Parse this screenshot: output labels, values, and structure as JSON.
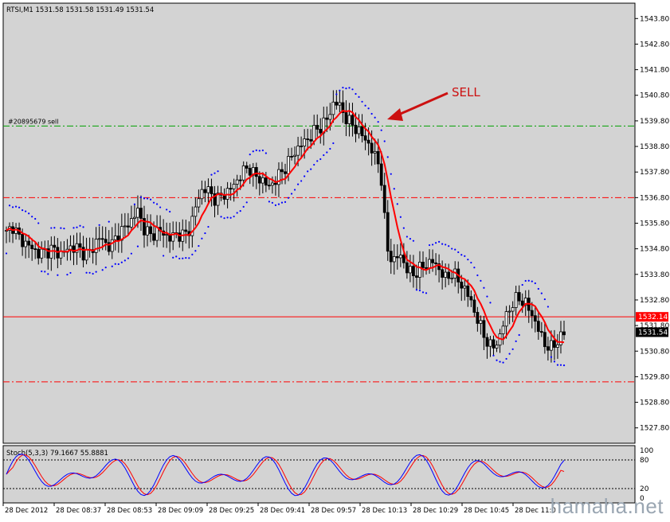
{
  "window": {
    "symbol_info": "RTSI,M1  1531.58 1531.58 1531.49 1531.54",
    "order_label": "#20895679 sell",
    "annotation": "SELL",
    "watermark": "hamaha.net"
  },
  "colors": {
    "background": "#d3d3d3",
    "candles": "#000000",
    "ma_line": "#ff0000",
    "parabolic_sar": "#0000ff",
    "order_line": "#00a000",
    "level_lines": "#ff0000",
    "stoch_main": "#0000ff",
    "stoch_signal": "#ff0000",
    "annotation": "#cc1111"
  },
  "price_axis": {
    "labels": [
      "1543.80",
      "1542.80",
      "1541.80",
      "1540.80",
      "1539.80",
      "1538.80",
      "1537.80",
      "1536.80",
      "1535.80",
      "1534.80",
      "1533.80",
      "1532.80",
      "1531.80",
      "1530.80",
      "1529.80",
      "1528.80",
      "1527.80"
    ],
    "current_price_tag": "1532.14",
    "last_price_tag": "1531.54"
  },
  "time_axis": {
    "labels": [
      "28 Dec 2012",
      "28 Dec 08:37",
      "28 Dec 08:53",
      "28 Dec 09:09",
      "28 Dec 09:25",
      "28 Dec 09:41",
      "28 Dec 09:57",
      "28 Dec 10:13",
      "28 Dec 10:29",
      "28 Dec 10:45",
      "28 Dec 11:0"
    ]
  },
  "stochastic": {
    "label": "Stoch(5,3,3) 79.1667 55.8881",
    "levels": [
      "100",
      "80",
      "20",
      "0"
    ]
  },
  "chart_data": {
    "type": "candlestick",
    "symbol": "RTSI",
    "timeframe": "M1",
    "price_range": [
      1527.2,
      1544.4
    ],
    "horizontal_lines": [
      {
        "price": 1539.6,
        "label": "#20895679 sell",
        "color": "#00a000"
      },
      {
        "price": 1536.8,
        "color": "#ff0000"
      },
      {
        "price": 1532.14,
        "color": "#ff0000"
      },
      {
        "price": 1529.6,
        "color": "#ff0000"
      }
    ],
    "close_path": [
      1535.4,
      1535.7,
      1535.2,
      1535.0,
      1534.8,
      1534.6,
      1534.7,
      1534.8,
      1534.6,
      1534.7,
      1534.9,
      1534.8,
      1534.6,
      1534.7,
      1535.3,
      1535.0,
      1534.9,
      1535.4,
      1535.6,
      1535.9,
      1536.3,
      1535.6,
      1535.3,
      1535.5,
      1535.4,
      1535.2,
      1535.4,
      1535.3,
      1535.6,
      1536.6,
      1537.2,
      1537.0,
      1536.7,
      1536.9,
      1537.1,
      1537.4,
      1537.8,
      1538.0,
      1537.6,
      1537.5,
      1537.2,
      1537.5,
      1537.8,
      1538.2,
      1538.6,
      1538.9,
      1539.1,
      1539.4,
      1539.6,
      1539.9,
      1540.6,
      1540.3,
      1539.8,
      1539.6,
      1539.3,
      1539.0,
      1538.5,
      1538.0,
      1534.8,
      1534.3,
      1534.6,
      1534.0,
      1533.8,
      1534.0,
      1534.2,
      1534.3,
      1534.0,
      1533.6,
      1533.9,
      1533.5,
      1533.2,
      1532.6,
      1531.9,
      1531.3,
      1530.9,
      1531.2,
      1532.1,
      1532.6,
      1532.9,
      1532.7,
      1532.3,
      1531.7,
      1531.1,
      1530.9,
      1531.2,
      1531.5
    ],
    "ma_period_hint": 7,
    "stochastic": {
      "k_range": [
        0,
        100
      ],
      "levels": [
        80,
        20
      ],
      "last_k": 79.1667,
      "last_d": 55.8881
    }
  }
}
